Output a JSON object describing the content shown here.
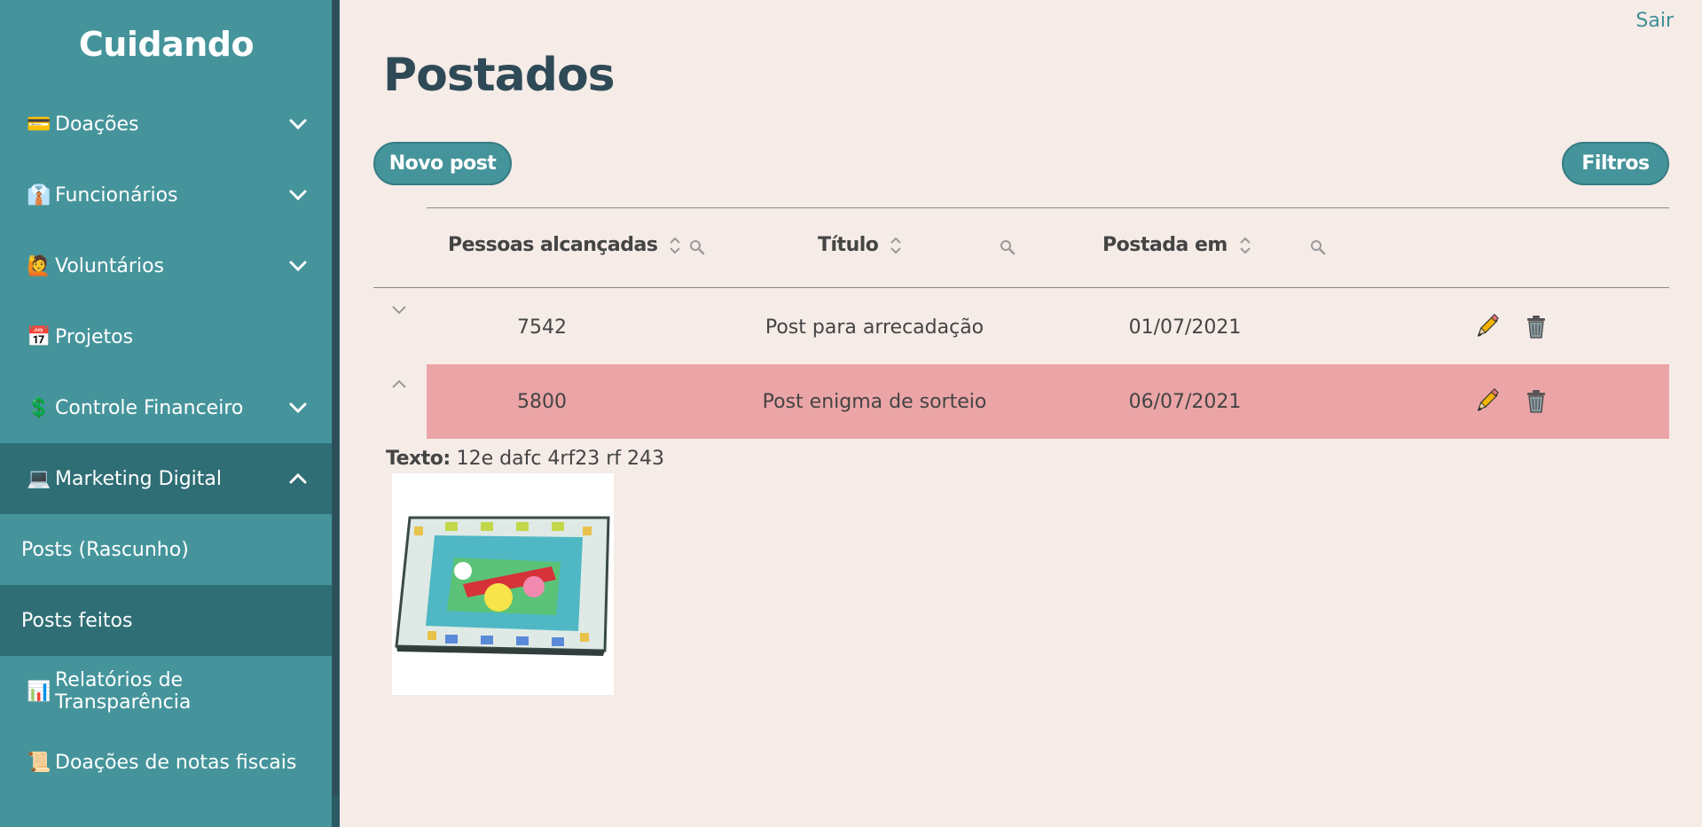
{
  "sidebar": {
    "brand": "Cuidando",
    "items": [
      {
        "emoji": "💳",
        "label": "Doações",
        "chevron": "down"
      },
      {
        "emoji": "👔",
        "label": "Funcionários",
        "chevron": "down"
      },
      {
        "emoji": "🙋",
        "label": "Voluntários",
        "chevron": "down"
      },
      {
        "emoji": "📅",
        "label": "Projetos",
        "chevron": ""
      },
      {
        "emoji": "💲",
        "label": "Controle Financeiro",
        "chevron": "down"
      },
      {
        "emoji": "💻",
        "label": "Marketing Digital",
        "chevron": "up"
      }
    ],
    "subitems": [
      {
        "label": "Posts (Rascunho)"
      },
      {
        "label": "Posts feitos"
      }
    ],
    "items_after": [
      {
        "emoji": "📊",
        "label": "Relatórios de Transparência"
      },
      {
        "emoji": "📜",
        "label": "Doações de notas fiscais"
      }
    ]
  },
  "header": {
    "logout": "Sair",
    "title": "Postados"
  },
  "toolbar": {
    "new_post": "Novo post",
    "filters": "Filtros"
  },
  "table": {
    "columns": [
      "Pessoas alcançadas",
      "Título",
      "Postada em"
    ],
    "rows": [
      {
        "reach": "7542",
        "title": "Post para arrecadação",
        "date": "01/07/2021",
        "expanded": false
      },
      {
        "reach": "5800",
        "title": "Post enigma de sorteio",
        "date": "06/07/2021",
        "expanded": true
      }
    ],
    "detail": {
      "label": "Texto:",
      "text": "12e dafc 4rf23 rf 243"
    }
  },
  "colors": {
    "sidebar": "#45949b",
    "sidebar_active": "#2f6e75",
    "background": "#f5ebe7",
    "row_highlight": "#eba5a6",
    "title": "#2f4a57"
  }
}
